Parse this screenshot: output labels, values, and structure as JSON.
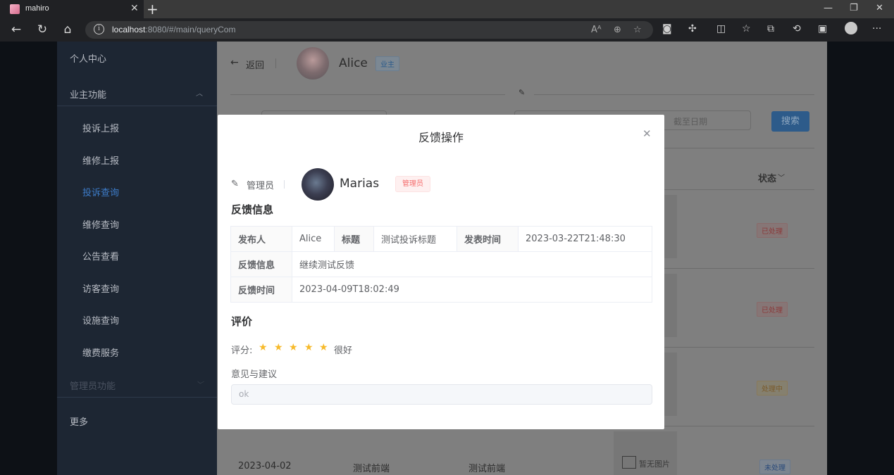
{
  "browser": {
    "tab_title": "mahiro",
    "url_host": "localhost",
    "url_rest": ":8080/#/main/queryCom"
  },
  "sidebar": {
    "items": [
      {
        "label": "个人中心"
      },
      {
        "label": "业主功能"
      },
      {
        "label": "投诉上报"
      },
      {
        "label": "维修上报"
      },
      {
        "label": "投诉查询"
      },
      {
        "label": "维修查询"
      },
      {
        "label": "公告查看"
      },
      {
        "label": "访客查询"
      },
      {
        "label": "设施查询"
      },
      {
        "label": "缴费服务"
      },
      {
        "label": "管理员功能"
      },
      {
        "label": "更多"
      }
    ]
  },
  "header": {
    "back_label": "返回",
    "user_name": "Alice",
    "user_tag": "业主"
  },
  "filters": {
    "end_date_placeholder": "截至日期",
    "search_button": "搜索"
  },
  "table": {
    "status_header": "状态",
    "statuses": [
      "已处理",
      "已处理",
      "处理中",
      "未处理"
    ],
    "no_image_text": "暂无图片",
    "last_row": {
      "date": "2023-04-02",
      "title": "测试前端",
      "content": "测试前端"
    }
  },
  "dialog": {
    "title": "反馈操作",
    "admin_label": "管理员",
    "admin_name": "Marias",
    "admin_tag": "管理员",
    "feedback_section": "反馈信息",
    "fields": {
      "sender_key": "发布人",
      "sender_val": "Alice",
      "title_key": "标题",
      "title_val": "测试投诉标题",
      "time_key": "发表时间",
      "time_val": "2023-03-22T21:48:30",
      "feedback_key": "反馈信息",
      "feedback_val": "继续测试反馈",
      "feedback_time_key": "反馈时间",
      "feedback_time_val": "2023-04-09T18:02:49"
    },
    "rating_section": "评价",
    "rating_label": "评分:",
    "rating_value": 5,
    "rating_text": "很好",
    "suggestion_label": "意见与建议",
    "suggestion_value": "ok"
  },
  "colors": {
    "accent": "#409eff",
    "sidebar_bg": "#1d2633",
    "star": "#f7ba2a",
    "danger": "#f56c6c"
  }
}
